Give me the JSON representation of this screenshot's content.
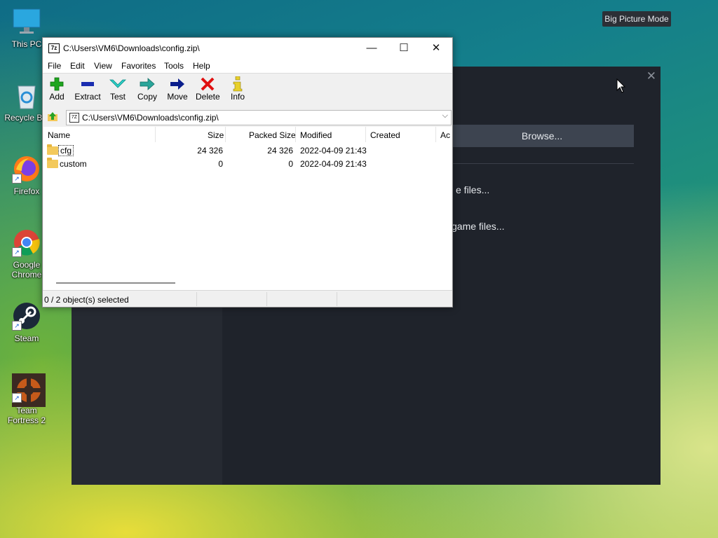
{
  "desktop": {
    "icons": [
      {
        "label": "This PC"
      },
      {
        "label": "Recycle Bin"
      },
      {
        "label": "Firefox"
      },
      {
        "label": "Google Chrome"
      },
      {
        "label": "Steam"
      },
      {
        "label": "Team Fortress 2"
      }
    ],
    "big_picture_label": "Big Picture Mode"
  },
  "steam_dialog": {
    "browse_label": "Browse...",
    "verify_label": "e files...",
    "game_files_label": "game files..."
  },
  "zip_window": {
    "title": "C:\\Users\\VM6\\Downloads\\config.zip\\",
    "menu": [
      "File",
      "Edit",
      "View",
      "Favorites",
      "Tools",
      "Help"
    ],
    "toolbar": [
      "Add",
      "Extract",
      "Test",
      "Copy",
      "Move",
      "Delete",
      "Info"
    ],
    "address": "C:\\Users\\VM6\\Downloads\\config.zip\\",
    "columns": [
      "Name",
      "Size",
      "Packed Size",
      "Modified",
      "Created",
      "Ac"
    ],
    "rows": [
      {
        "name": "cfg",
        "size": "24 326",
        "packed": "24 326",
        "modified": "2022-04-09 21:43",
        "created": ""
      },
      {
        "name": "custom",
        "size": "0",
        "packed": "0",
        "modified": "2022-04-09 21:43",
        "created": ""
      }
    ],
    "status": "0 / 2 object(s) selected"
  },
  "colors": {
    "steam_bg": "#1f232b",
    "steam_button": "#3d4450",
    "add_green": "#1fa51f",
    "delete_red": "#e01010",
    "move_navy": "#0a1e8c"
  }
}
